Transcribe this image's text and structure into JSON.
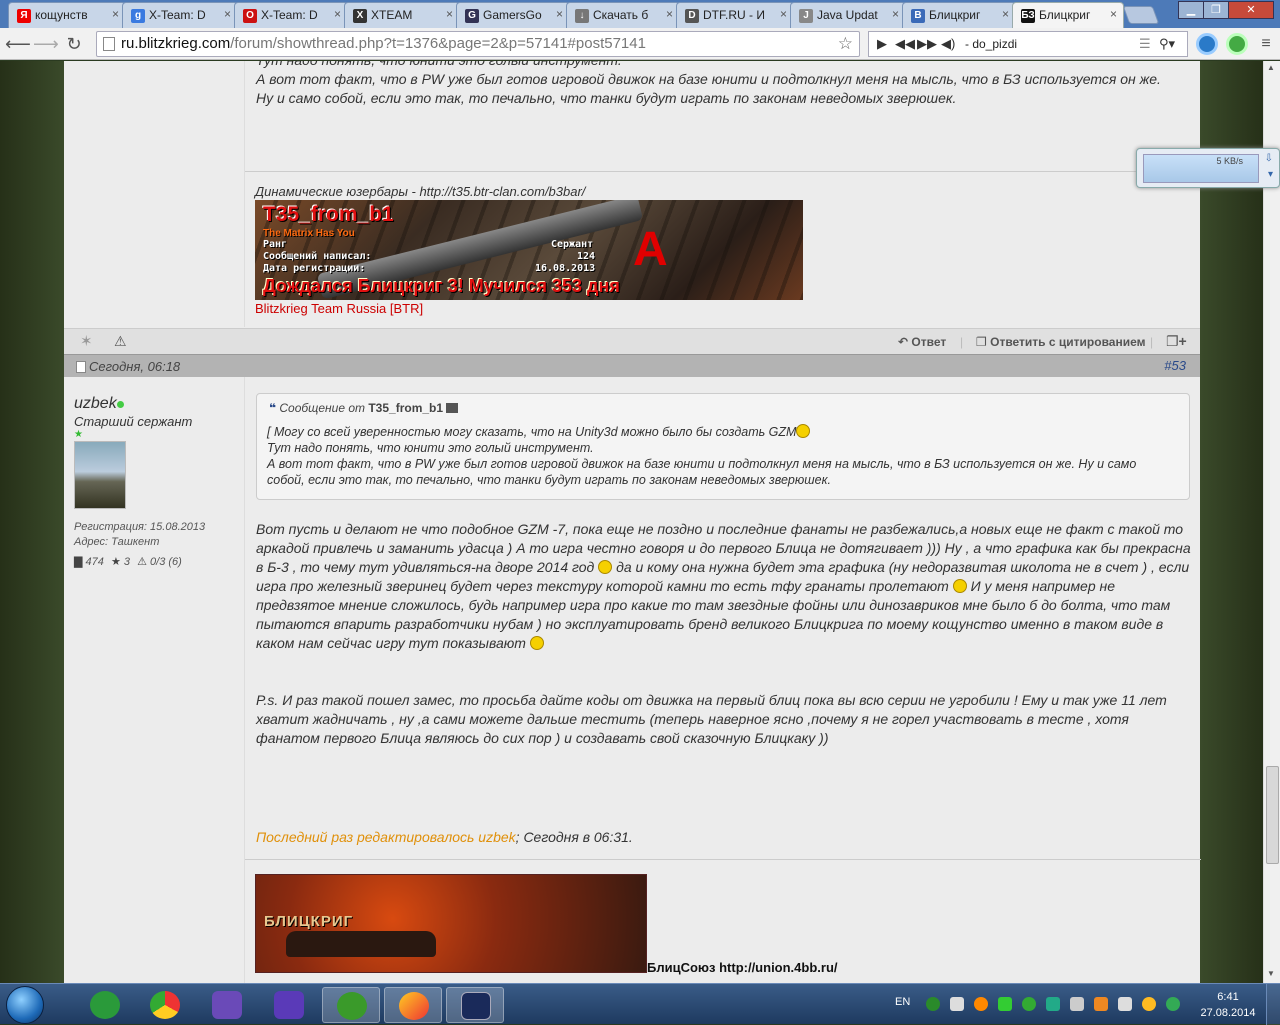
{
  "browser": {
    "tabs": [
      {
        "label": "кощунств",
        "fav": "Я",
        "color": "#e00"
      },
      {
        "label": "X-Team: D",
        "fav": "g",
        "color": "#3a7ae0"
      },
      {
        "label": "X-Team: D",
        "fav": "O",
        "color": "#c11"
      },
      {
        "label": "XTEAM",
        "fav": "X",
        "color": "#333"
      },
      {
        "label": "GamersGo",
        "fav": "G",
        "color": "#335"
      },
      {
        "label": "Скачать б",
        "fav": "↓",
        "color": "#777"
      },
      {
        "label": "DTF.RU - И",
        "fav": "D",
        "color": "#555"
      },
      {
        "label": "Java Updat",
        "fav": "J",
        "color": "#888"
      },
      {
        "label": "Блицкриг",
        "fav": "B",
        "color": "#3a6ab8"
      },
      {
        "label": "Блицкриг",
        "fav": "БЗ",
        "color": "#111"
      }
    ],
    "url_host": "ru.blitzkrieg.com",
    "url_path": "/forum/showthread.php?t=1376&page=2&p=57141#post57141",
    "player_track": "- do_pizdi",
    "win_min": "▁",
    "win_max": "❐",
    "win_close": "✕"
  },
  "post1": {
    "line1": "Тут надо понять, что юнити это голый инструмент.",
    "line2": "А вот тот факт, что в PW уже был готов игровой движок на базе юнити и подтолкнул меня на мысль, что в БЗ используется он же.",
    "line3": "Ну и само собой, если это так, то печально, что танки будут играть по законам неведомых зверюшек.",
    "sig_label": "Динамические юзербары - http://t35.btr-clan.com/b3bar/",
    "banner": {
      "name": "T35_from_b1",
      "motto": "The Matrix Has You",
      "rank_label": "Ранг",
      "rank": "Сержант",
      "posts_label": "Сообщений написал:",
      "posts": "124",
      "reg_label": "Дата регистрации:",
      "reg": "16.08.2013",
      "letter": "А",
      "footer": "Дождался Блицкриг 3! Мучился 353 дня"
    },
    "clan_link": "Blitzkrieg Team Russia [BTR]"
  },
  "actions": {
    "reply": "Ответ",
    "reply_quote": "Ответить с цитированием"
  },
  "post2": {
    "date": "Сегодня, 06:18",
    "number": "#53",
    "user": {
      "name": "uzbek",
      "title": "Старший сержант",
      "reg": "Регистрация: 15.08.2013",
      "address": "Адрес: Ташкент",
      "posts": "474",
      "stars": "3",
      "warnings": "0/3 (6)"
    },
    "quote_prefix": "Сообщение от",
    "quote_author": "T35_from_b1",
    "quote_l1": "[ Могу со всей уверенностью могу сказать, что на Unity3d можно было бы создать GZM",
    "quote_l2": "Тут надо понять, что юнити это голый инструмент.",
    "quote_l3": "А вот тот факт, что в PW уже был готов игровой движок на базе юнити и подтолкнул меня на мысль, что в БЗ используется он же. Ну и само собой, если это так, то печально, что танки будут играть по законам неведомых зверюшек.",
    "msg_a": "Вот пусть и делают не что подобное GZM -7, пока еще не поздно и последние фанаты не разбежались,а новых еще не факт с такой то аркадой привлечь и заманить удасца ) А то игра честно говоря и до первого Блица не дотягивает ))) Ну , а что графика как бы прекрасна в Б-3 , то чему тут удивляться-на дворе 2014 год",
    "msg_b": "да и кому она нужна будет эта графика (ну недоразвитая школота не в счет ) , если игра про железный зверинец будет через текстуру которой камни то есть тфу гранаты пролетают",
    "msg_c": "И у меня например не предвзятое мнение сложилось, будь например игра про какие то там звездные фойны или динозавриков мне было б до болта, что там пытаются впарить разработчики нубам ) но эксплуатировать бренд великого Блицкрига по моему кощунство именно в таком виде в каком нам сейчас игру тут показывают",
    "ps": "P.s. И раз такой пошел замес, то просьба дайте коды от движка на первый блиц пока вы всю серии не угробили ! Ему и так уже 11 лет хватит жадничать , ну ,а сами можете дальше тестить (теперь наверное ясно ,почему я не горел участвовать в тесте , хотя фанатом первого Блица являюсь до сих пор ) и создавать свой сказочную Блицкаку ))",
    "edited_link": "Последний раз редактировалось uzbek",
    "edited_time": "; Сегодня в 06:31.",
    "banner_logo": "БЛИЦКРИГ",
    "union": "БлицСоюз http://union.4bb.ru/"
  },
  "speed_widget": {
    "rate": "5 KB/s"
  },
  "taskbar": {
    "lang": "EN",
    "time": "6:41",
    "date": "27.08.2014"
  }
}
